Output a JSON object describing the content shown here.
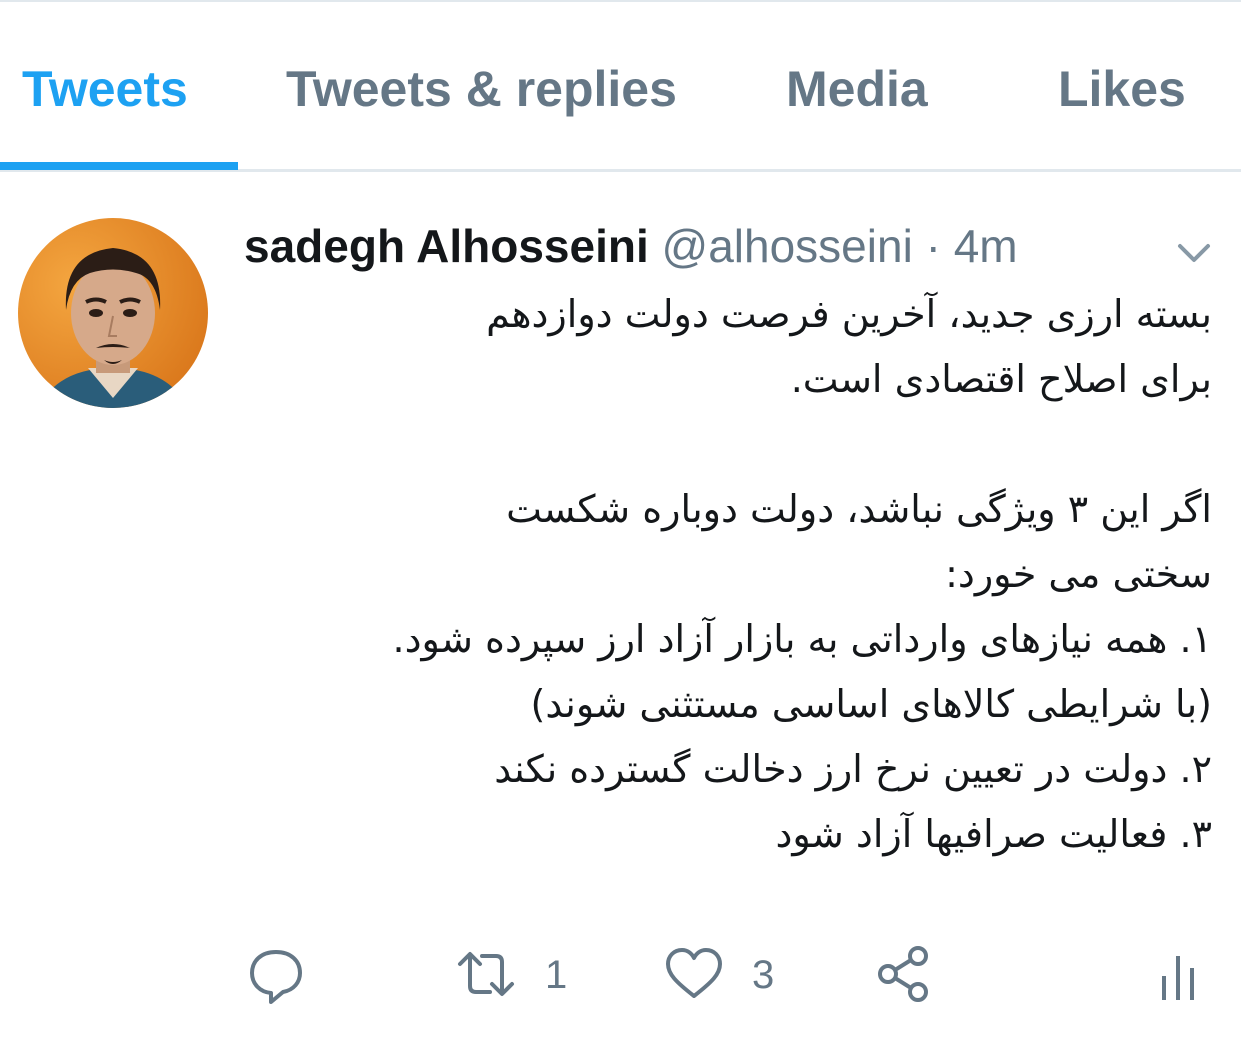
{
  "tabs": [
    {
      "label": "Tweets",
      "active": true
    },
    {
      "label": "Tweets & replies",
      "active": false
    },
    {
      "label": "Media",
      "active": false
    },
    {
      "label": "Likes",
      "active": false
    }
  ],
  "tweet": {
    "display_name": "sadegh Alhosseini",
    "handle": "@alhosseini",
    "separator": "·",
    "time": "4m",
    "lines": [
      "بسته ارزی جدید، آخرین فرصت دولت دوازدهم",
      "برای اصلاح اقتصادی است.",
      "",
      "اگر این ۳ ویژگی نباشد، دولت دوباره شکست",
      "سختی می خورد:",
      "۱. همه نیازهای وارداتی به بازار آزاد ارز سپرده شود.",
      "(با شرایطی کالاهای اساسی مستثنی شوند)",
      "۲. دولت در تعیین نرخ ارز دخالت گسترده نکند",
      "۳.  فعالیت صرافیها آزاد شود"
    ],
    "retweet_count": "1",
    "like_count": "3"
  },
  "colors": {
    "accent": "#1da1f2",
    "muted": "#657786",
    "text": "#14171a",
    "border": "#e1e8ed"
  },
  "icons": [
    "reply-icon",
    "retweet-icon",
    "like-icon",
    "share-icon",
    "analytics-icon",
    "chevron-down-icon"
  ]
}
